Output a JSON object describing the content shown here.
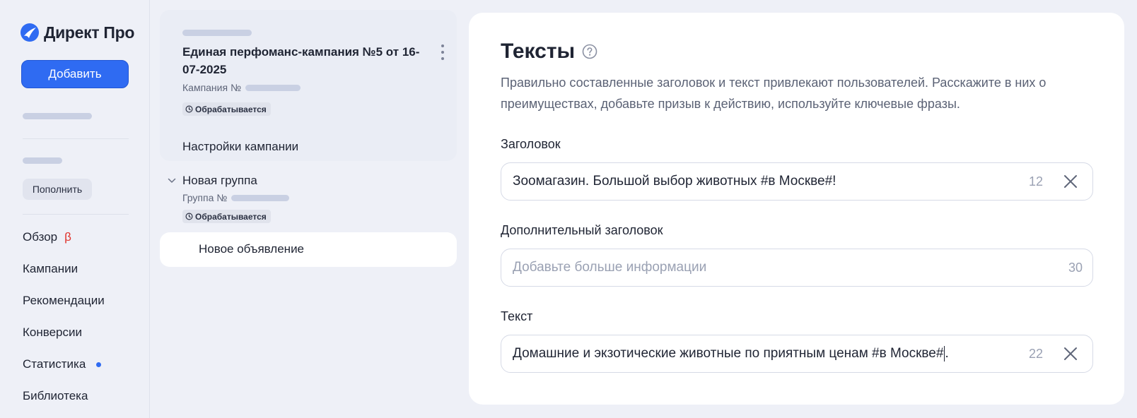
{
  "app": {
    "brand": "Директ Про"
  },
  "sidebar": {
    "add_label": "Добавить",
    "topup_label": "Пополнить",
    "nav": [
      {
        "label": "Обзор",
        "badge": "β"
      },
      {
        "label": "Кампании"
      },
      {
        "label": "Рекомендации"
      },
      {
        "label": "Конверсии"
      },
      {
        "label": "Статистика",
        "has_dot": true
      },
      {
        "label": "Библиотека"
      }
    ]
  },
  "campaign": {
    "title": "Единая перфоманс-кампания №5 от 16-07-2025",
    "number_label": "Кампания №",
    "status": "Обрабатывается",
    "settings_label": "Настройки кампании",
    "group": {
      "title": "Новая группа",
      "number_label": "Группа №",
      "status": "Обрабатывается"
    },
    "ad_label": "Новое объявление"
  },
  "panel": {
    "title": "Тексты",
    "description": "Правильно составленные заголовок и текст привлекают пользователей. Расскажите в них о преимуществах, добавьте призыв к действию, используйте ключевые фразы.",
    "fields": [
      {
        "label": "Заголовок",
        "value": "Зоомагазин. Большой выбор животных #в Москве#!",
        "counter": "12"
      },
      {
        "label": "Дополнительный заголовок",
        "placeholder": "Добавьте больше информации",
        "counter": "30"
      },
      {
        "label": "Текст",
        "value_before_caret": "Домашние и экзотические животные по приятным ценам #в Москве#",
        "value_after_caret": ".",
        "counter": "22"
      }
    ]
  },
  "colors": {
    "accent": "#2f6bf2",
    "background": "#eef0f7",
    "beta": "#e0322b"
  }
}
